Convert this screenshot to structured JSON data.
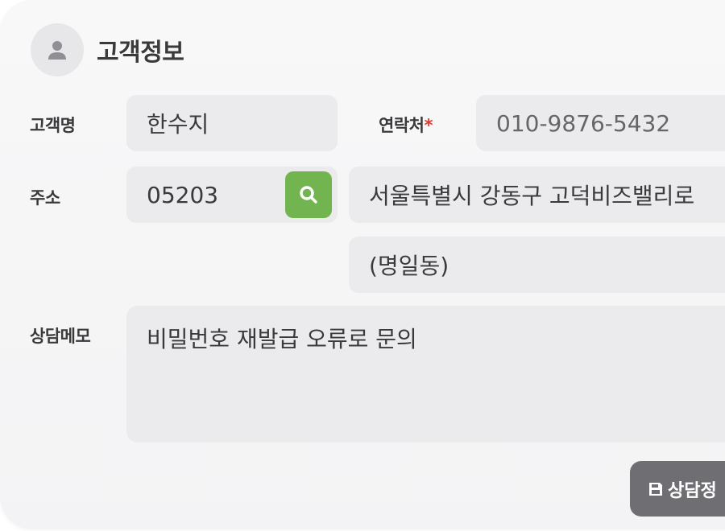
{
  "header": {
    "title": "고객정보",
    "avatar_icon": "user-icon"
  },
  "form": {
    "name_label": "고객명",
    "name_value": "한수지",
    "phone_label": "연락처",
    "phone_required_mark": "*",
    "phone_value": "010-9876-5432",
    "address_label": "주소",
    "zipcode_value": "05203",
    "search_icon": "search-icon",
    "address1_value": "서울특별시 강동구 고덕비즈밸리로",
    "address2_value": "(명일동)",
    "memo_label": "상담메모",
    "memo_value": "비밀번호 재발급 오류로 문의"
  },
  "actions": {
    "save_label": "상담정",
    "save_icon": "floppy-disk-icon"
  },
  "colors": {
    "search_button": "#72b44f",
    "required": "#e5392f",
    "save_button": "#6f6f73",
    "field_bg": "#ebebee"
  }
}
